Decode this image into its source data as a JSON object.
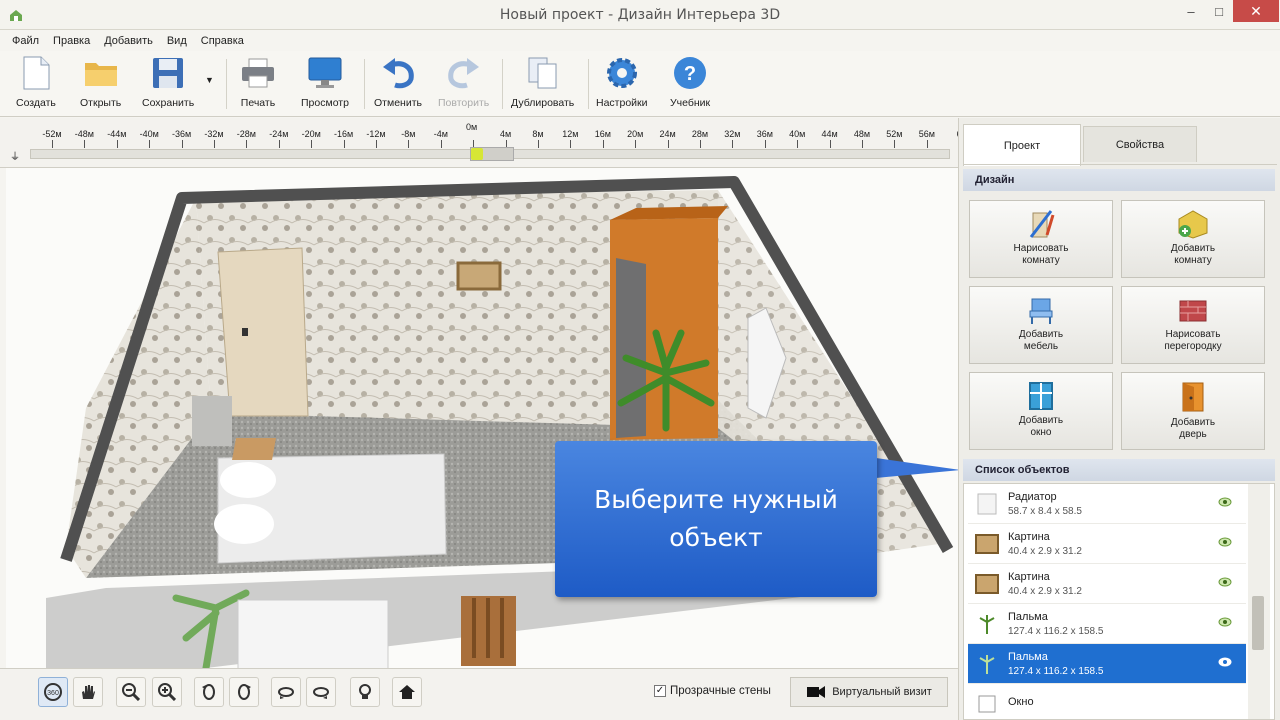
{
  "window": {
    "title": "Новый проект - Дизайн Интерьера 3D",
    "min": "–",
    "max": "□",
    "close": "✕"
  },
  "menu": [
    "Файл",
    "Правка",
    "Добавить",
    "Вид",
    "Справка"
  ],
  "toolbar": {
    "create": "Создать",
    "open": "Открыть",
    "save": "Сохранить",
    "print": "Печать",
    "preview": "Просмотр",
    "undo": "Отменить",
    "redo": "Повторить",
    "duplicate": "Дублировать",
    "settings": "Настройки",
    "tutorial": "Учебник"
  },
  "ruler": {
    "zero": "0м",
    "ticks": [
      "-52м",
      "-48м",
      "-44м",
      "-40м",
      "-36м",
      "-32м",
      "-28м",
      "-24м",
      "-20м",
      "-16м",
      "-12м",
      "-8м",
      "-4м",
      "",
      "4м",
      "8м",
      "12м",
      "16м",
      "20м",
      "24м",
      "28м",
      "32м",
      "36м",
      "40м",
      "44м",
      "48м",
      "52м",
      "56м",
      "6"
    ]
  },
  "bottom": {
    "transparent_walls": "Прозрачные стены",
    "virtual_visit": "Виртуальный визит",
    "transparent_checked": true
  },
  "panel": {
    "tabs": {
      "project": "Проект",
      "properties": "Свойства"
    },
    "design_header": "Дизайн",
    "design_buttons": [
      {
        "label": "Нарисовать\nкомнату",
        "icon": "draw-room-icon"
      },
      {
        "label": "Добавить\nкомнату",
        "icon": "add-room-icon"
      },
      {
        "label": "Добавить\nмебель",
        "icon": "add-furniture-icon"
      },
      {
        "label": "Нарисовать\nперегородку",
        "icon": "draw-partition-icon"
      },
      {
        "label": "Добавить\nокно",
        "icon": "add-window-icon"
      },
      {
        "label": "Добавить\nдверь",
        "icon": "add-door-icon"
      }
    ],
    "objects_header": "Список объектов",
    "objects": [
      {
        "name": "Радиатор",
        "dims": "58.7 x 8.4 x 58.5",
        "icon": "radiator-icon",
        "selected": false
      },
      {
        "name": "Картина",
        "dims": "40.4 x 2.9 x 31.2",
        "icon": "picture-icon",
        "selected": false
      },
      {
        "name": "Картина",
        "dims": "40.4 x 2.9 x 31.2",
        "icon": "picture-icon",
        "selected": false
      },
      {
        "name": "Пальма",
        "dims": "127.4 x 116.2 x 158.5",
        "icon": "palm-icon",
        "selected": false
      },
      {
        "name": "Пальма",
        "dims": "127.4 x 116.2 x 158.5",
        "icon": "palm-icon",
        "selected": true
      },
      {
        "name": "Окно",
        "dims": "",
        "icon": "window-icon",
        "selected": false
      }
    ]
  },
  "callout": {
    "text": "Выберите нужный объект"
  }
}
